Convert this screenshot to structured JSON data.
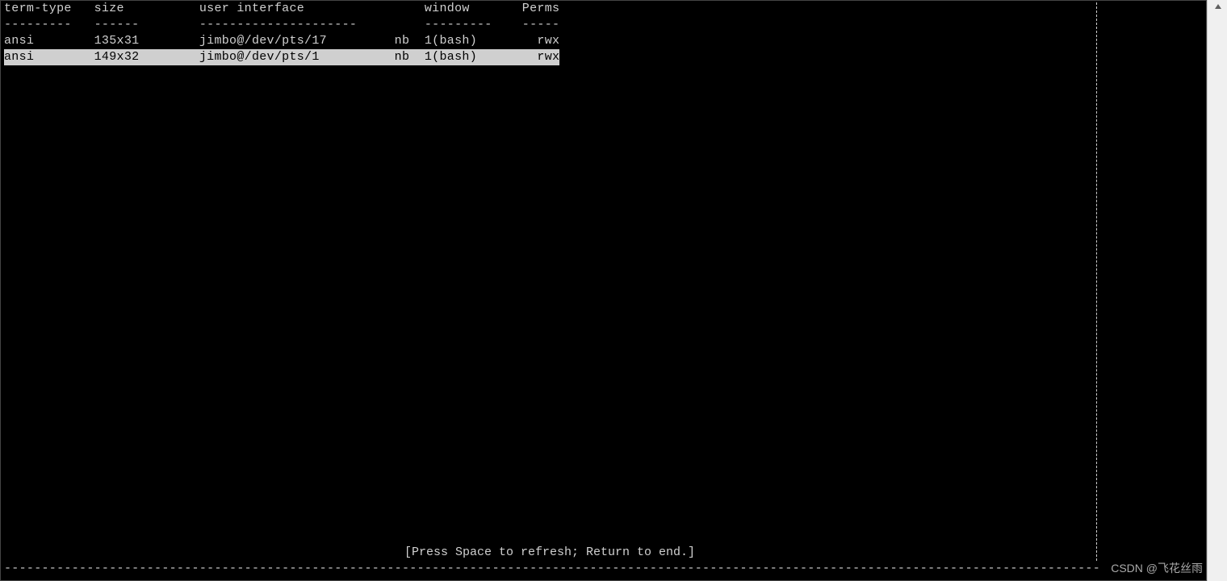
{
  "headers": {
    "term_type": "term-type",
    "size": "size",
    "user_interface": "user interface",
    "window": "window",
    "perms": "Perms"
  },
  "header_dashes": {
    "term_type": "---------",
    "size": "------",
    "user_interface": "---------------------",
    "window": "---------",
    "perms": "-----"
  },
  "rows": [
    {
      "term_type": "ansi",
      "size": "135x31",
      "user_interface": "jimbo@/dev/pts/17",
      "flag": "nb",
      "window": "1(bash)",
      "perms": "rwx",
      "selected": false
    },
    {
      "term_type": "ansi",
      "size": "149x32",
      "user_interface": "jimbo@/dev/pts/1",
      "flag": "nb",
      "window": "1(bash)",
      "perms": "rwx",
      "selected": true
    }
  ],
  "hint": "[Press Space to refresh; Return to end.]",
  "watermark": "CSDN @飞花丝雨"
}
